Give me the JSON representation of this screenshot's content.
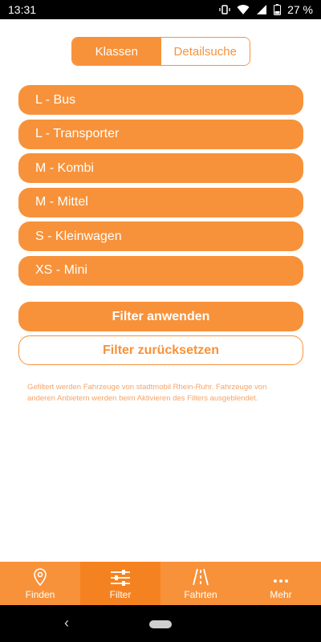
{
  "status_bar": {
    "time": "13:31",
    "battery": "27 %"
  },
  "segment": {
    "active_label": "Klassen",
    "inactive_label": "Detailsuche"
  },
  "classes": [
    {
      "label": "L - Bus"
    },
    {
      "label": "L - Transporter"
    },
    {
      "label": "M - Kombi"
    },
    {
      "label": "M - Mittel"
    },
    {
      "label": "S - Kleinwagen"
    },
    {
      "label": "XS - Mini"
    }
  ],
  "actions": {
    "apply_label": "Filter anwenden",
    "reset_label": "Filter zurücksetzen"
  },
  "info_text": "Gefiltert werden Fahrzeuge von stadtmobil Rhein-Ruhr. Fahrzeuge von anderen Anbietern werden beim Aktivieren des Filters ausgeblendet.",
  "bottom_nav": [
    {
      "label": "Finden",
      "icon": "location-pin-icon"
    },
    {
      "label": "Filter",
      "icon": "sliders-icon",
      "active": true
    },
    {
      "label": "Fahrten",
      "icon": "road-icon"
    },
    {
      "label": "Mehr",
      "icon": "more-dots-icon"
    }
  ],
  "colors": {
    "accent": "#f7923a",
    "accent_dark": "#f58220",
    "info_text": "#f3a468"
  }
}
